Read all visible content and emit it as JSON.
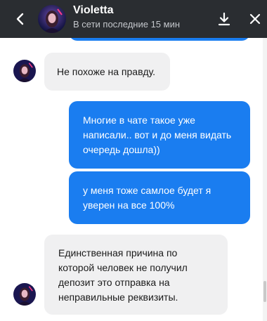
{
  "header": {
    "name": "Violetta",
    "status": "В сети последние 15 мин",
    "icons": {
      "back": "chevron-left-icon",
      "download": "download-icon",
      "close": "close-icon"
    }
  },
  "messages": [
    {
      "direction": "outgoing",
      "text": ""
    },
    {
      "direction": "incoming",
      "text": "Не похоже на правду."
    },
    {
      "direction": "outgoing",
      "text": "Многие в чате такое уже написали.. вот и до меня видать очередь дошла))"
    },
    {
      "direction": "outgoing",
      "text": "у меня тоже самлое будет я уверен на все 100%"
    },
    {
      "direction": "incoming",
      "text": "Единственная причина по которой человек не получил депозит это отправка на неправильные реквизиты."
    }
  ],
  "colors": {
    "header_bg": "#2a2d31",
    "outgoing_bubble": "#1a7df0",
    "incoming_bubble": "#f0f0f1"
  }
}
